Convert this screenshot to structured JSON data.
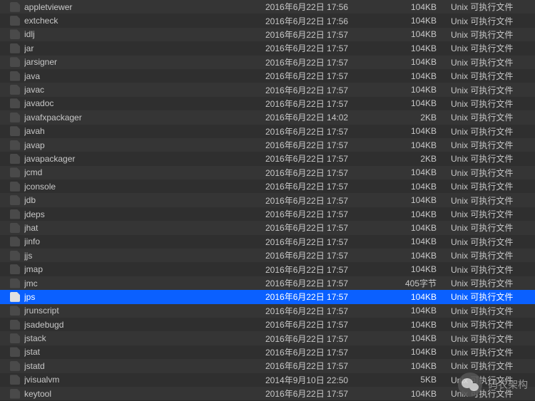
{
  "files": [
    {
      "name": "appletviewer",
      "date": "2016年6月22日 17:56",
      "size": "104KB",
      "kind": "Unix 可执行文件",
      "selected": false
    },
    {
      "name": "extcheck",
      "date": "2016年6月22日 17:56",
      "size": "104KB",
      "kind": "Unix 可执行文件",
      "selected": false
    },
    {
      "name": "idlj",
      "date": "2016年6月22日 17:57",
      "size": "104KB",
      "kind": "Unix 可执行文件",
      "selected": false
    },
    {
      "name": "jar",
      "date": "2016年6月22日 17:57",
      "size": "104KB",
      "kind": "Unix 可执行文件",
      "selected": false
    },
    {
      "name": "jarsigner",
      "date": "2016年6月22日 17:57",
      "size": "104KB",
      "kind": "Unix 可执行文件",
      "selected": false
    },
    {
      "name": "java",
      "date": "2016年6月22日 17:57",
      "size": "104KB",
      "kind": "Unix 可执行文件",
      "selected": false
    },
    {
      "name": "javac",
      "date": "2016年6月22日 17:57",
      "size": "104KB",
      "kind": "Unix 可执行文件",
      "selected": false
    },
    {
      "name": "javadoc",
      "date": "2016年6月22日 17:57",
      "size": "104KB",
      "kind": "Unix 可执行文件",
      "selected": false
    },
    {
      "name": "javafxpackager",
      "date": "2016年6月22日 14:02",
      "size": "2KB",
      "kind": "Unix 可执行文件",
      "selected": false
    },
    {
      "name": "javah",
      "date": "2016年6月22日 17:57",
      "size": "104KB",
      "kind": "Unix 可执行文件",
      "selected": false
    },
    {
      "name": "javap",
      "date": "2016年6月22日 17:57",
      "size": "104KB",
      "kind": "Unix 可执行文件",
      "selected": false
    },
    {
      "name": "javapackager",
      "date": "2016年6月22日 17:57",
      "size": "2KB",
      "kind": "Unix 可执行文件",
      "selected": false
    },
    {
      "name": "jcmd",
      "date": "2016年6月22日 17:57",
      "size": "104KB",
      "kind": "Unix 可执行文件",
      "selected": false
    },
    {
      "name": "jconsole",
      "date": "2016年6月22日 17:57",
      "size": "104KB",
      "kind": "Unix 可执行文件",
      "selected": false
    },
    {
      "name": "jdb",
      "date": "2016年6月22日 17:57",
      "size": "104KB",
      "kind": "Unix 可执行文件",
      "selected": false
    },
    {
      "name": "jdeps",
      "date": "2016年6月22日 17:57",
      "size": "104KB",
      "kind": "Unix 可执行文件",
      "selected": false
    },
    {
      "name": "jhat",
      "date": "2016年6月22日 17:57",
      "size": "104KB",
      "kind": "Unix 可执行文件",
      "selected": false
    },
    {
      "name": "jinfo",
      "date": "2016年6月22日 17:57",
      "size": "104KB",
      "kind": "Unix 可执行文件",
      "selected": false
    },
    {
      "name": "jjs",
      "date": "2016年6月22日 17:57",
      "size": "104KB",
      "kind": "Unix 可执行文件",
      "selected": false
    },
    {
      "name": "jmap",
      "date": "2016年6月22日 17:57",
      "size": "104KB",
      "kind": "Unix 可执行文件",
      "selected": false
    },
    {
      "name": "jmc",
      "date": "2016年6月22日 17:57",
      "size": "405字节",
      "kind": "Unix 可执行文件",
      "selected": false
    },
    {
      "name": "jps",
      "date": "2016年6月22日 17:57",
      "size": "104KB",
      "kind": "Unix 可执行文件",
      "selected": true
    },
    {
      "name": "jrunscript",
      "date": "2016年6月22日 17:57",
      "size": "104KB",
      "kind": "Unix 可执行文件",
      "selected": false
    },
    {
      "name": "jsadebugd",
      "date": "2016年6月22日 17:57",
      "size": "104KB",
      "kind": "Unix 可执行文件",
      "selected": false
    },
    {
      "name": "jstack",
      "date": "2016年6月22日 17:57",
      "size": "104KB",
      "kind": "Unix 可执行文件",
      "selected": false
    },
    {
      "name": "jstat",
      "date": "2016年6月22日 17:57",
      "size": "104KB",
      "kind": "Unix 可执行文件",
      "selected": false
    },
    {
      "name": "jstatd",
      "date": "2016年6月22日 17:57",
      "size": "104KB",
      "kind": "Unix 可执行文件",
      "selected": false
    },
    {
      "name": "jvisualvm",
      "date": "2014年9月10日 22:50",
      "size": "5KB",
      "kind": "Unix 可执行文件",
      "selected": false
    },
    {
      "name": "keytool",
      "date": "2016年6月22日 17:57",
      "size": "104KB",
      "kind": "Unix 可执行文件",
      "selected": false
    }
  ],
  "watermark": {
    "text": "码农架构"
  }
}
